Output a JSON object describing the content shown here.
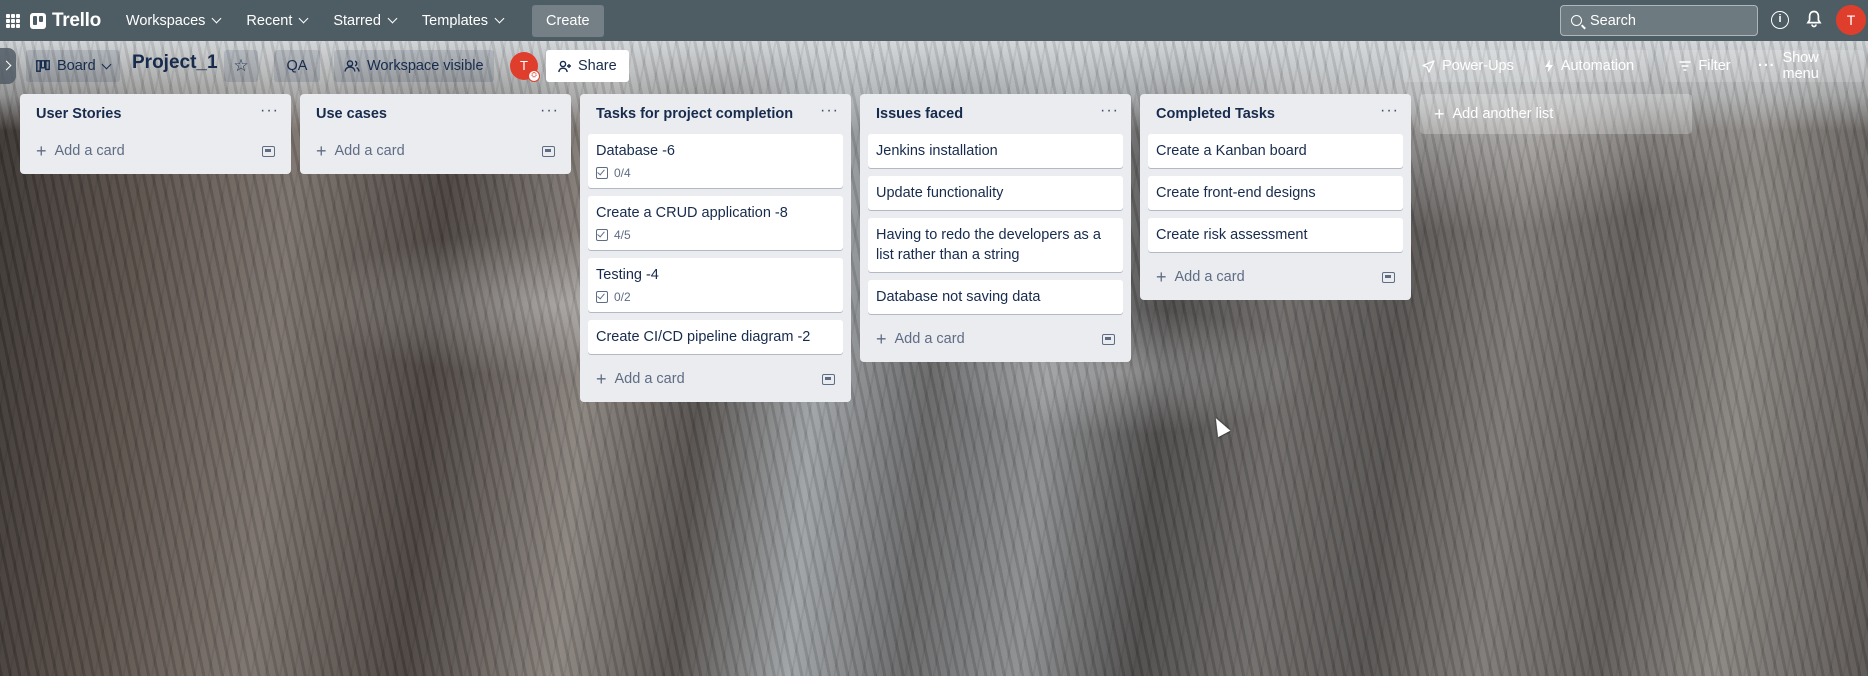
{
  "topnav": {
    "brand": "Trello",
    "menus": [
      {
        "label": "Workspaces"
      },
      {
        "label": "Recent"
      },
      {
        "label": "Starred"
      },
      {
        "label": "Templates"
      }
    ],
    "create_label": "Create",
    "search_placeholder": "Search",
    "user_initial": "T"
  },
  "board": {
    "view_label": "Board",
    "title": "Project_1",
    "qa_label": "QA",
    "visibility_label": "Workspace visible",
    "share_label": "Share",
    "member_initial": "T",
    "powerups_label": "Power-Ups",
    "automation_label": "Automation",
    "filter_label": "Filter",
    "show_menu_label": "Show menu"
  },
  "lists": [
    {
      "title": "User Stories",
      "cards": [],
      "add_card_label": "Add a card"
    },
    {
      "title": "Use cases",
      "cards": [],
      "add_card_label": "Add a card"
    },
    {
      "title": "Tasks for project completion",
      "cards": [
        {
          "title": "Database -6",
          "checklist": "0/4"
        },
        {
          "title": "Create a CRUD application -8",
          "checklist": "4/5"
        },
        {
          "title": "Testing -4",
          "checklist": "0/2"
        },
        {
          "title": "Create CI/CD pipeline diagram -2"
        }
      ],
      "add_card_label": "Add a card"
    },
    {
      "title": "Issues faced",
      "cards": [
        {
          "title": "Jenkins installation"
        },
        {
          "title": "Update functionality"
        },
        {
          "title": "Having to redo the developers as a list rather than a string"
        },
        {
          "title": "Database not saving data"
        }
      ],
      "add_card_label": "Add a card"
    },
    {
      "title": "Completed Tasks",
      "cards": [
        {
          "title": "Create a Kanban board"
        },
        {
          "title": "Create front-end designs"
        },
        {
          "title": "Create risk assessment"
        }
      ],
      "add_card_label": "Add a card"
    }
  ],
  "add_list_label": "Add another list",
  "colors": {
    "topnav": "#4e5d64",
    "list_bg": "#ebecf0",
    "avatar": "#e03e2d"
  }
}
